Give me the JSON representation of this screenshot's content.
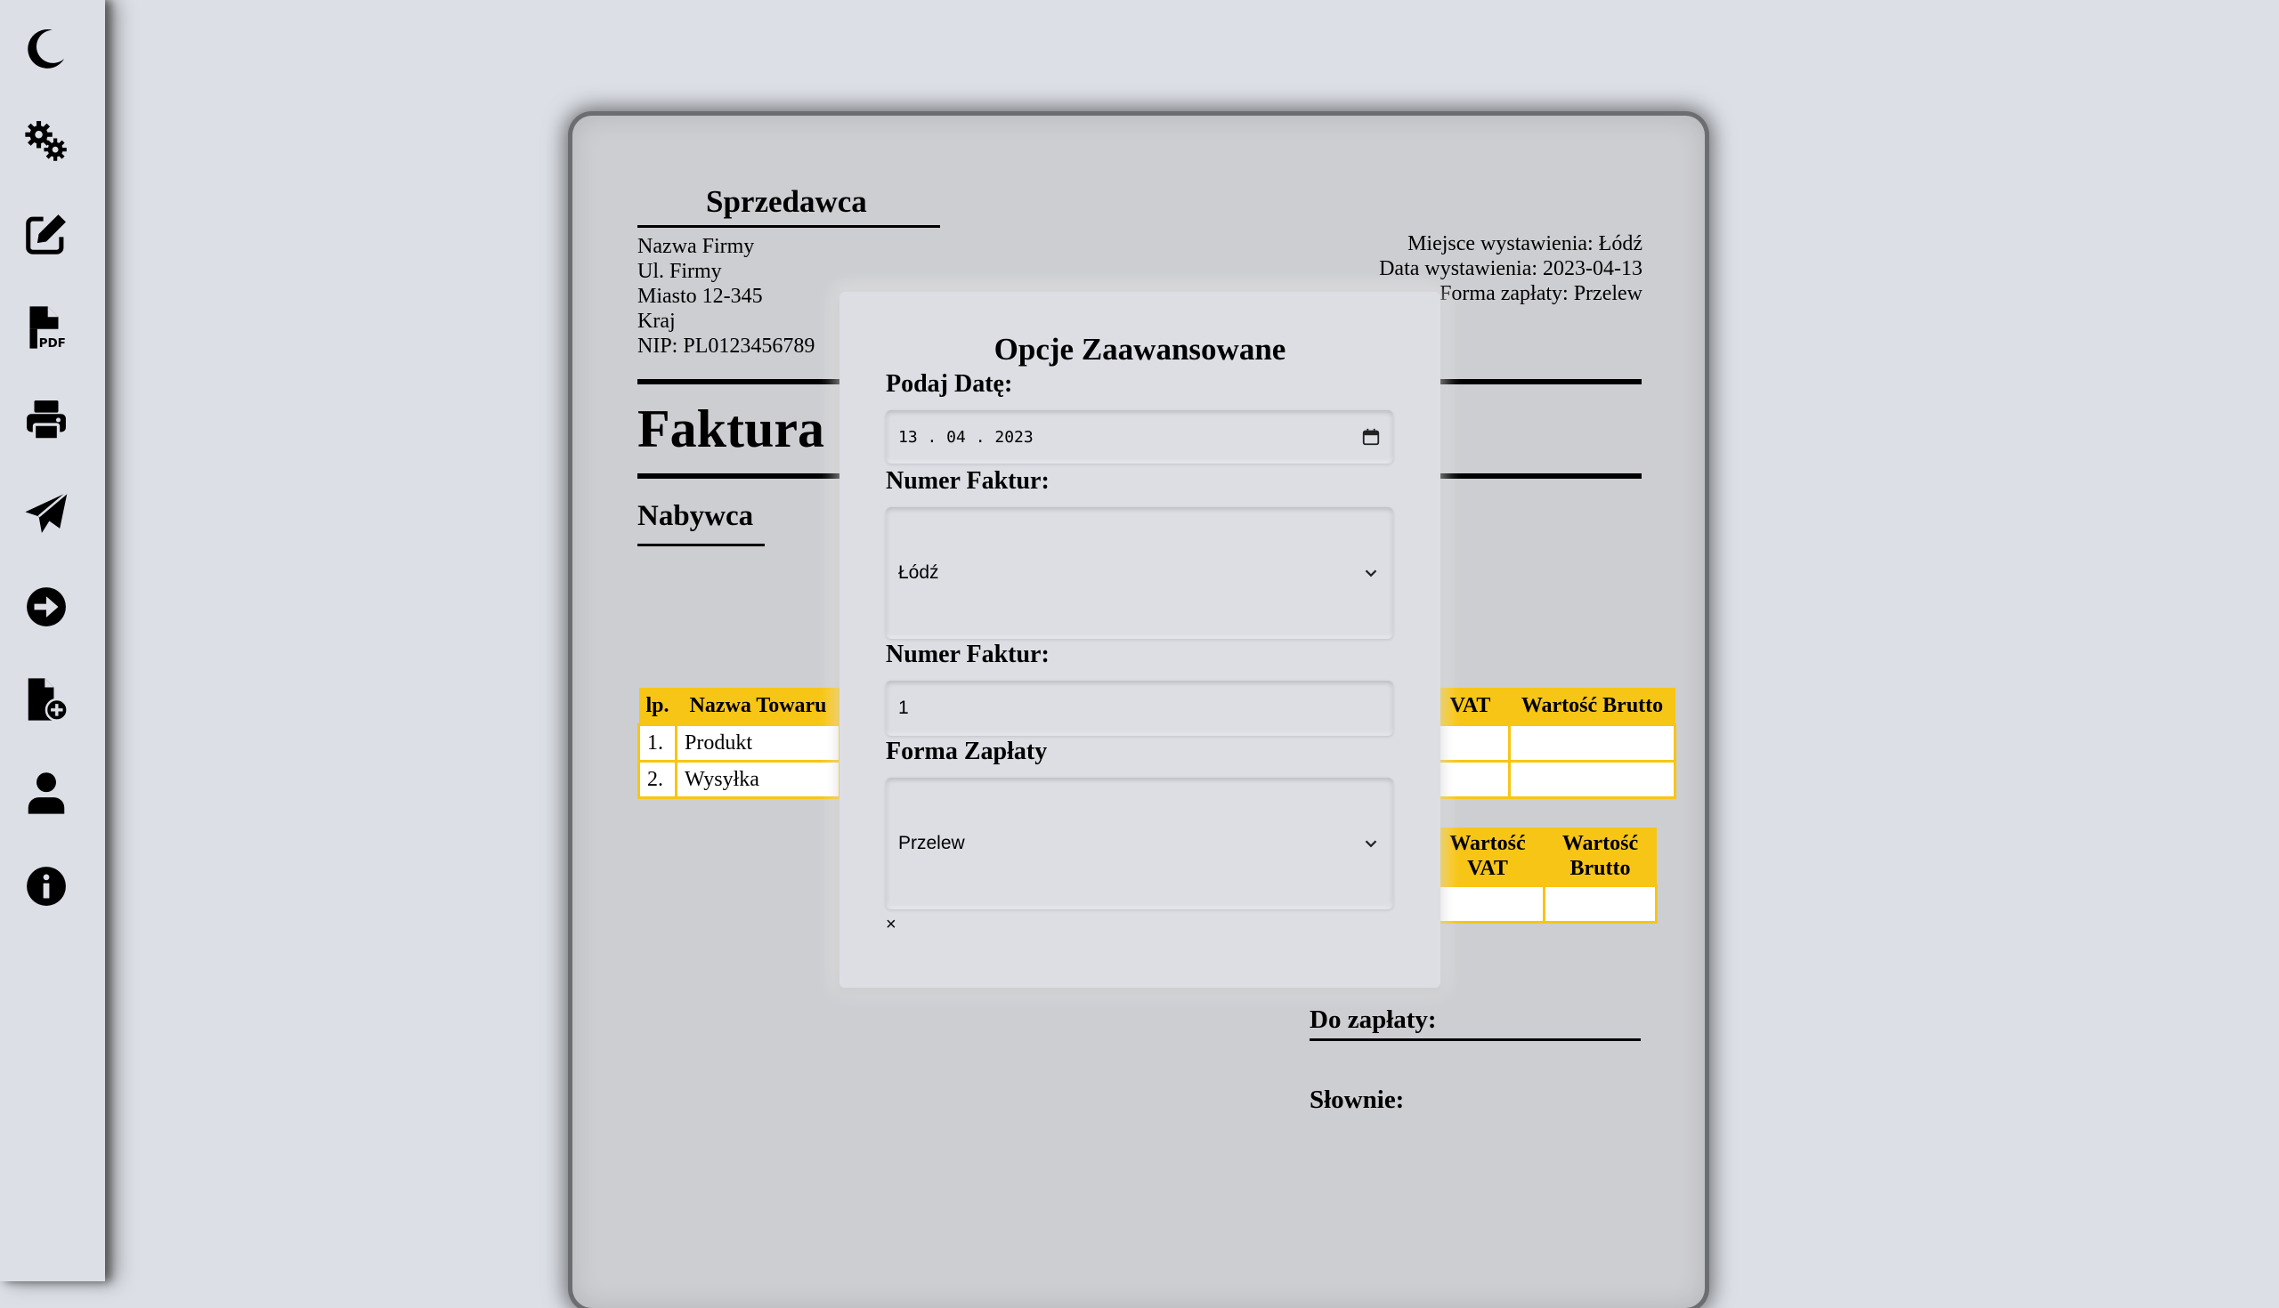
{
  "sidebar": {
    "items": [
      {
        "name": "theme-toggle-button",
        "icon": "moon-icon"
      },
      {
        "name": "settings-button",
        "icon": "gears-icon"
      },
      {
        "name": "edit-button",
        "icon": "edit-icon"
      },
      {
        "name": "pdf-button",
        "icon": "file-pdf-icon"
      },
      {
        "name": "print-button",
        "icon": "print-icon"
      },
      {
        "name": "send-button",
        "icon": "paper-plane-icon"
      },
      {
        "name": "next-button",
        "icon": "arrow-circle-right-icon"
      },
      {
        "name": "new-invoice-button",
        "icon": "file-plus-icon"
      },
      {
        "name": "account-button",
        "icon": "user-icon"
      },
      {
        "name": "info-button",
        "icon": "info-icon"
      }
    ]
  },
  "invoice": {
    "seller_title": "Sprzedawca",
    "seller_lines": [
      "Nazwa Firmy",
      "Ul. Firmy",
      "Miasto 12-345",
      "Kraj",
      "NIP: PL0123456789"
    ],
    "place_lines": [
      "Miejsce wystawienia: Łódź",
      "Data wystawienia: 2023-04-13",
      "Forma zapłaty: Przelew"
    ],
    "title": "Faktura",
    "buyer_title": "Nabywca",
    "items_table": {
      "headers": [
        "lp.",
        "Nazwa Towaru",
        "VAT",
        "Wartość Brutto"
      ],
      "rows": [
        {
          "lp": "1.",
          "name": "Produkt"
        },
        {
          "lp": "2.",
          "name": "Wysyłka"
        }
      ]
    },
    "summary_table": {
      "headers": [
        "Wartość VAT",
        "Wartość Brutto"
      ]
    },
    "to_pay_label": "Do zapłaty:",
    "in_words_label": "Słownie:"
  },
  "modal": {
    "title": "Opcje Zaawansowane",
    "date_label": "Podaj Datę:",
    "date_value": "13 . 04 . 2023",
    "place_label": "Numer Faktur:",
    "place_value": "Łódź",
    "number_label": "Numer Faktur:",
    "number_value": "1",
    "payment_label": "Forma Zapłaty",
    "payment_value": "Przelew",
    "close_label": "×"
  },
  "colors": {
    "accent": "#f7c515",
    "background": "#dcdfe6",
    "sheet": "#cdced1"
  }
}
